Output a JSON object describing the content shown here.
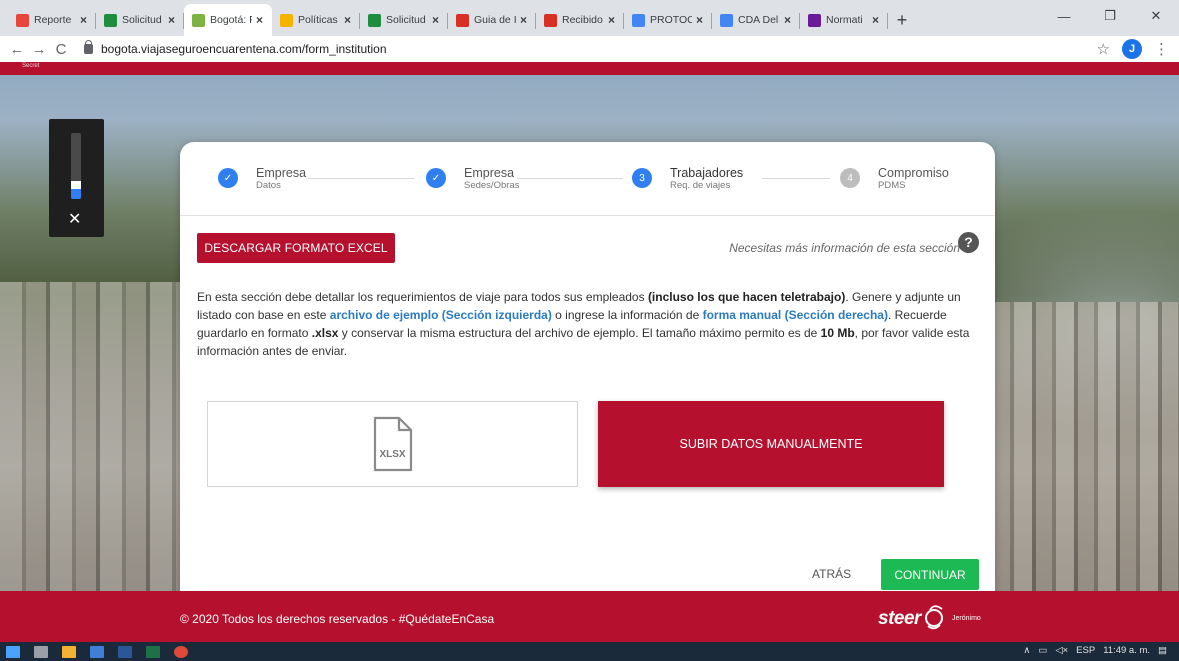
{
  "browser": {
    "tabs": [
      {
        "label": "Reporte",
        "favicon": "star-icon",
        "color": "#e8453c"
      },
      {
        "label": "Solicitud",
        "favicon": "sheets-icon",
        "color": "#1e8e3e"
      },
      {
        "label": "Bogotá: F",
        "favicon": "sun-icon",
        "color": "#7cb342",
        "active": true
      },
      {
        "label": "Políticas",
        "favicon": "shield-icon",
        "color": "#f4b400"
      },
      {
        "label": "Solicitud",
        "favicon": "sheets-icon",
        "color": "#1e8e3e"
      },
      {
        "label": "Guia de I",
        "favicon": "pdf-icon",
        "color": "#d93025"
      },
      {
        "label": "Recibido",
        "favicon": "gmail-icon",
        "color": "#d93025"
      },
      {
        "label": "PROTOC",
        "favicon": "docs-icon",
        "color": "#4285f4"
      },
      {
        "label": "CDA Del",
        "favicon": "drive-icon",
        "color": "#4285f4"
      },
      {
        "label": "Normati",
        "favicon": "gov-icon",
        "color": "#6a1b9a"
      }
    ],
    "new_tab": "+",
    "url": "bogota.viajaseguroencuarentena.com/form_institution",
    "profile_initial": "J"
  },
  "header": {
    "band_text": "Secret"
  },
  "widget": {
    "volume_level": 0.15
  },
  "stepper": {
    "steps": [
      {
        "number": "✓",
        "title": "Empresa",
        "subtitle": "Datos",
        "state": "done"
      },
      {
        "number": "✓",
        "title": "Empresa",
        "subtitle": "Sedes/Obras",
        "state": "done"
      },
      {
        "number": "3",
        "title": "Trabajadores",
        "subtitle": "Req. de viajes",
        "state": "current"
      },
      {
        "number": "4",
        "title": "Compromiso",
        "subtitle": "PDMS",
        "state": "pending"
      }
    ]
  },
  "actions": {
    "download_label": "DESCARGAR FORMATO EXCEL",
    "help_text": "Necesitas más información de esta sección",
    "help_icon": "?"
  },
  "description": {
    "p1": "En esta sección debe detallar los requerimientos de viaje para todos sus empleados ",
    "b1": "(incluso los que hacen teletrabajo)",
    "p2": ". Genere y adjunte un listado con base en este ",
    "l1": "archivo de ejemplo (Sección izquierda)",
    "p3": " o ingrese la información de ",
    "l2": "forma manual (Sección derecha)",
    "p4": ". Recuerde guardarlo en formato ",
    "b2": ".xlsx",
    "p5": " y conservar la misma estructura del archivo de ejemplo. El tamaño máximo permito es de ",
    "b3": "10 Mb",
    "p6": ", por favor valide esta información antes de enviar."
  },
  "upload": {
    "file_label": "XLSX",
    "manual_label": "SUBIR DATOS MANUALMENTE"
  },
  "nav": {
    "back_label": "ATRÁS",
    "continue_label": "CONTINUAR"
  },
  "footer": {
    "copyright": "© 2020 Todos los derechos reservados - #QuédateEnCasa",
    "logo_text": "steer",
    "logo_sub": "Jerónimo"
  },
  "taskbar": {
    "language": "ESP",
    "time": "11:49 a. m."
  },
  "colors": {
    "brand_red": "#b5112e",
    "step_blue": "#2f7ff0",
    "continue_green": "#1db954",
    "link_blue": "#2a7bbf"
  }
}
